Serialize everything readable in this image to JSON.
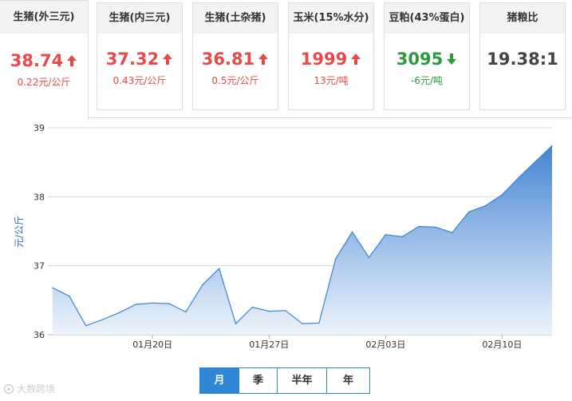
{
  "cards": [
    {
      "title": "生猪(外三元)",
      "value": "38.74",
      "change": "0.22元/公斤",
      "trend": "up"
    },
    {
      "title": "生猪(内三元)",
      "value": "37.32",
      "change": "0.43元/公斤",
      "trend": "up"
    },
    {
      "title": "生猪(土杂猪)",
      "value": "36.81",
      "change": "0.5元/公斤",
      "trend": "up"
    },
    {
      "title": "玉米(15%水分)",
      "value": "1999",
      "change": "13元/吨",
      "trend": "up"
    },
    {
      "title": "豆粕(43%蛋白)",
      "value": "3095",
      "change": "-6元/吨",
      "trend": "down"
    },
    {
      "title": "猪粮比",
      "value": "19.38:1",
      "change": "",
      "trend": "flat"
    }
  ],
  "colors": {
    "up": "#e64a4a",
    "down": "#2e9a3e",
    "line": "#3d85cf",
    "area_top": "#3b7fd1",
    "area_bottom": "#eaf2fb",
    "grid": "#d9d9d9",
    "accent": "#2f86d4"
  },
  "chart_data": {
    "type": "area",
    "ylabel": "元/公斤",
    "ylim": [
      36,
      39
    ],
    "yticks": [
      36,
      37,
      38,
      39
    ],
    "grid": true,
    "x_tick_labels": [
      {
        "index": 6,
        "label": "01月20日"
      },
      {
        "index": 13,
        "label": "01月27日"
      },
      {
        "index": 20,
        "label": "02月03日"
      },
      {
        "index": 27,
        "label": "02月10日"
      }
    ],
    "series": [
      {
        "values": [
          36.68,
          36.56,
          36.13,
          36.22,
          36.32,
          36.44,
          36.46,
          36.45,
          36.33,
          36.72,
          36.96,
          36.16,
          36.4,
          36.34,
          36.35,
          36.16,
          36.17,
          37.1,
          37.49,
          37.12,
          37.45,
          37.42,
          37.57,
          37.56,
          37.48,
          37.78,
          37.87,
          38.03,
          38.28,
          38.51,
          38.74
        ]
      }
    ]
  },
  "range_tabs": [
    {
      "label": "月",
      "active": true
    },
    {
      "label": "季",
      "active": false
    },
    {
      "label": "半年",
      "active": false
    },
    {
      "label": "年",
      "active": false
    }
  ],
  "watermark": "大数跨境"
}
